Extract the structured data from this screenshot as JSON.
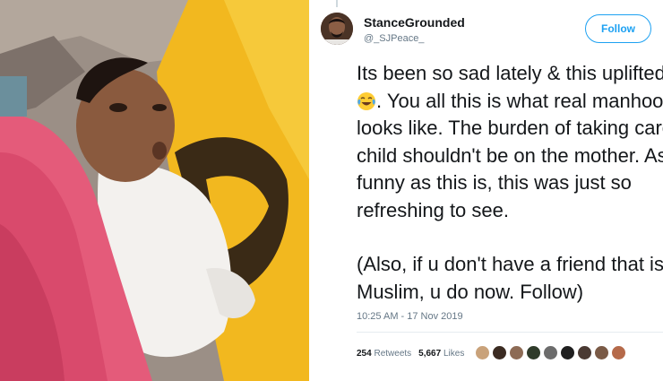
{
  "tweet": {
    "display_name": "StanceGrounded",
    "handle": "@_SJPeace_",
    "follow_label": "Follow",
    "lines": {
      "l1": "Its been so sad lately & this uplifted me",
      "l2": ". You all this is what real manhood",
      "l3": "looks like. The burden of taking care of a",
      "l4": "child shouldn't be on the mother. As",
      "l5": "funny as this is, this was just so",
      "l6": "refreshing to see.",
      "l7": "(Also, if u don't have a friend that is",
      "l8": "Muslim, u do now. Follow)"
    },
    "emoji": "face-with-tears-of-joy-icon",
    "timestamp": "10:25 AM - 17 Nov 2019",
    "retweets_count": "254",
    "retweets_label": "Retweets",
    "likes_count": "5,667",
    "likes_label": "Likes"
  },
  "colors": {
    "link_blue": "#1da1f2",
    "text_primary": "#14171a",
    "text_secondary": "#657786"
  }
}
